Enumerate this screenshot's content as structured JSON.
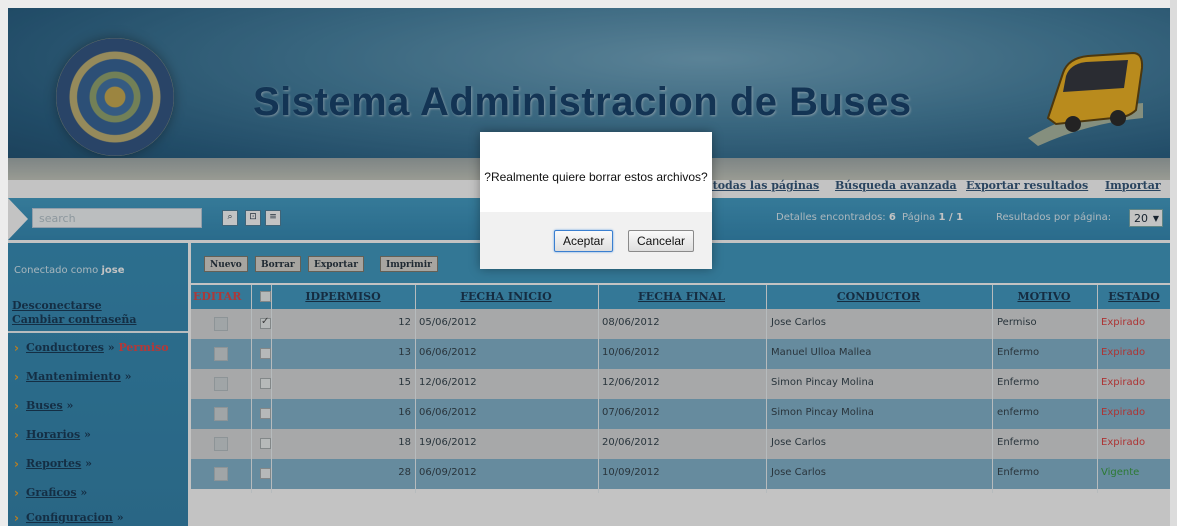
{
  "header": {
    "title": "Sistema Administracion de Buses",
    "links": [
      "r todas las páginas",
      "Búsqueda avanzada",
      "Exportar resultados",
      "Importar"
    ]
  },
  "toolbar": {
    "search_placeholder": "search",
    "icons": [
      "search-icon",
      "filter-icon",
      "options-icon"
    ],
    "found_label": "Detalles encontrados:",
    "found_count": "6",
    "page_label": "Página",
    "page_value": "1 / 1",
    "per_page_label": "Resultados por página:",
    "per_page_value": "20"
  },
  "sidebar": {
    "connected_prefix": "Conectado como",
    "user": "jose",
    "logout": "Desconectarse",
    "change_password": "Cambiar contraseña",
    "nav": [
      {
        "label": "Conductores",
        "current": "Permiso"
      },
      {
        "label": "Mantenimiento"
      },
      {
        "label": "Buses"
      },
      {
        "label": "Horarios"
      },
      {
        "label": "Reportes"
      },
      {
        "label": "Graficos"
      },
      {
        "label": "Configuracion"
      }
    ],
    "nav_suffix": "»"
  },
  "actions": [
    "Nuevo",
    "Borrar",
    "Exportar",
    "Imprimir"
  ],
  "table": {
    "columns": [
      "EDITAR",
      "IDPERMISO",
      "FECHA INICIO",
      "FECHA FINAL",
      "CONDUCTOR",
      "MOTIVO",
      "ESTADO"
    ],
    "rows": [
      {
        "id": "12",
        "inicio": "05/06/2012",
        "final": "08/06/2012",
        "conductor": "Jose Carlos",
        "motivo": "Permiso",
        "estado": "Expirado",
        "checked": true
      },
      {
        "id": "13",
        "inicio": "06/06/2012",
        "final": "10/06/2012",
        "conductor": "Manuel Ulloa Mallea",
        "motivo": "Enfermo",
        "estado": "Expirado",
        "checked": false
      },
      {
        "id": "15",
        "inicio": "12/06/2012",
        "final": "12/06/2012",
        "conductor": "Simon Pincay Molina",
        "motivo": "Enfermo",
        "estado": "Expirado",
        "checked": false
      },
      {
        "id": "16",
        "inicio": "06/06/2012",
        "final": "07/06/2012",
        "conductor": "Simon Pincay Molina",
        "motivo": "enfermo",
        "estado": "Expirado",
        "checked": false
      },
      {
        "id": "18",
        "inicio": "19/06/2012",
        "final": "20/06/2012",
        "conductor": "Jose Carlos",
        "motivo": "Enfermo",
        "estado": "Expirado",
        "checked": false
      },
      {
        "id": "28",
        "inicio": "06/09/2012",
        "final": "10/09/2012",
        "conductor": "Jose Carlos",
        "motivo": "Enfermo",
        "estado": "Vigente",
        "checked": false
      }
    ]
  },
  "dialog": {
    "message": "?Realmente quiere borrar estos archivos?",
    "ok": "Aceptar",
    "cancel": "Cancelar"
  },
  "colors": {
    "expired": "#e03a3a",
    "active": "#2f9a3a",
    "accent": "#3896c0"
  }
}
